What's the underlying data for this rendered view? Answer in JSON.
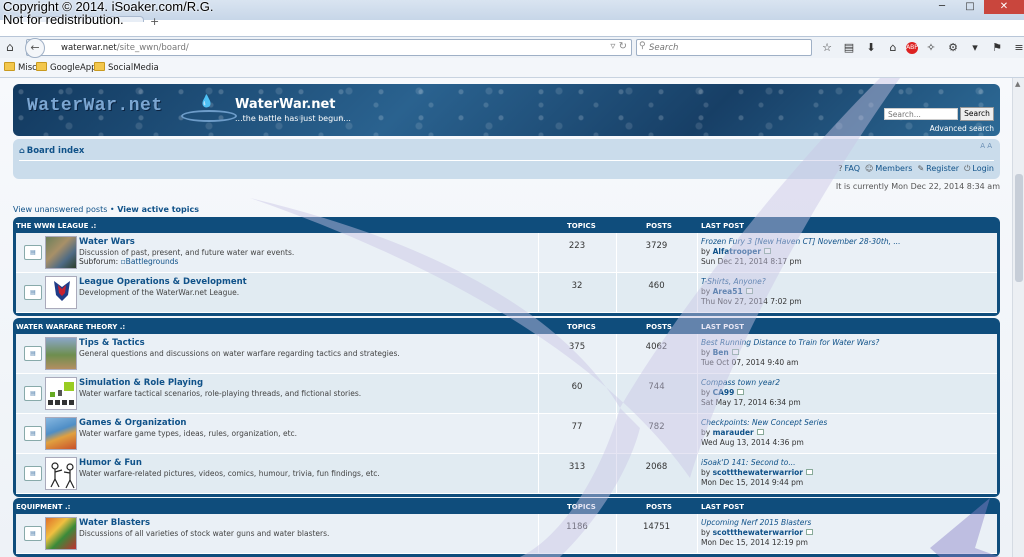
{
  "copyright": {
    "line1": "Copyright © 2014. iSoaker.com/R.G.",
    "line2": "Not for redistribution."
  },
  "browser": {
    "url_host": "waterwar.net",
    "url_path": "/site_wwn/board/",
    "search_placeholder": "Search",
    "bookmarks": [
      "Misc",
      "GoogleApps",
      "SocialMedia"
    ]
  },
  "header": {
    "logo_text": "WaterWar.net",
    "site_title": "WaterWar.net",
    "site_desc": "...the battle has just begun...",
    "search_placeholder": "Search...",
    "search_button": "Search",
    "advanced_search": "Advanced search"
  },
  "navbar": {
    "board_index": "Board index",
    "font_resize": "A A",
    "faq": "FAQ",
    "members": "Members",
    "register": "Register",
    "login": "Login"
  },
  "datetime": "It is currently Mon Dec 22, 2014 8:34 am",
  "view_links": {
    "unanswered": "View unanswered posts",
    "separator": " • ",
    "active": "View active topics"
  },
  "table_headers": {
    "topics": "TOPICS",
    "posts": "POSTS",
    "last_post": "LAST POST"
  },
  "categories": [
    {
      "title": "THE WWN LEAGUE .:",
      "forums": [
        {
          "name": "Water Wars",
          "desc": "Discussion of past, present, and future water war events.",
          "subforum_label": "Subforum:",
          "subforum": "Battlegrounds",
          "topics": "223",
          "posts": "3729",
          "last_title": "Frozen Fury 3 [New Haven CT] November 28-30th, ...",
          "last_by": "by",
          "last_user": "Alfatrooper",
          "last_date": "Sun Dec 21, 2014 8:17 pm"
        },
        {
          "name": "League Operations & Development",
          "desc": "Development of the WaterWar.net League.",
          "topics": "32",
          "posts": "460",
          "last_title": "T-Shirts, Anyone?",
          "last_by": "by",
          "last_user": "Area51",
          "last_date": "Thu Nov 27, 2014 7:02 pm"
        }
      ]
    },
    {
      "title": "WATER WARFARE THEORY .:",
      "forums": [
        {
          "name": "Tips & Tactics",
          "desc": "General questions and discussions on water warfare regarding tactics and strategies.",
          "topics": "375",
          "posts": "4062",
          "last_title": "Best Running Distance to Train for Water Wars?",
          "last_by": "by",
          "last_user": "Ben",
          "last_date": "Tue Oct 07, 2014 9:40 am"
        },
        {
          "name": "Simulation & Role Playing",
          "desc": "Water warfare tactical scenarios, role-playing threads, and fictional stories.",
          "topics": "60",
          "posts": "744",
          "last_title": "Compass town year2",
          "last_by": "by",
          "last_user": "CA99",
          "last_date": "Sat May 17, 2014 6:34 pm"
        },
        {
          "name": "Games & Organization",
          "desc": "Water warfare game types, ideas, rules, organization, etc.",
          "topics": "77",
          "posts": "782",
          "last_title": "Checkpoints: New Concept Series",
          "last_by": "by",
          "last_user": "marauder",
          "last_date": "Wed Aug 13, 2014 4:36 pm"
        },
        {
          "name": "Humor & Fun",
          "desc": "Water warfare-related pictures, videos, comics, humour, trivia, fun findings, etc.",
          "topics": "313",
          "posts": "2068",
          "last_title": "iSoak'D 141: Second to...",
          "last_by": "by",
          "last_user": "scottthewaterwarrior",
          "last_date": "Mon Dec 15, 2014 9:44 pm"
        }
      ]
    },
    {
      "title": "EQUIPMENT .:",
      "forums": [
        {
          "name": "Water Blasters",
          "desc": "Discussions of all varieties of stock water guns and water blasters.",
          "topics": "1186",
          "posts": "14751",
          "last_title": "Upcoming Nerf 2015 Blasters",
          "last_by": "by",
          "last_user": "scottthewaterwarrior",
          "last_date": "Mon Dec 15, 2014 12:19 pm"
        }
      ]
    }
  ]
}
